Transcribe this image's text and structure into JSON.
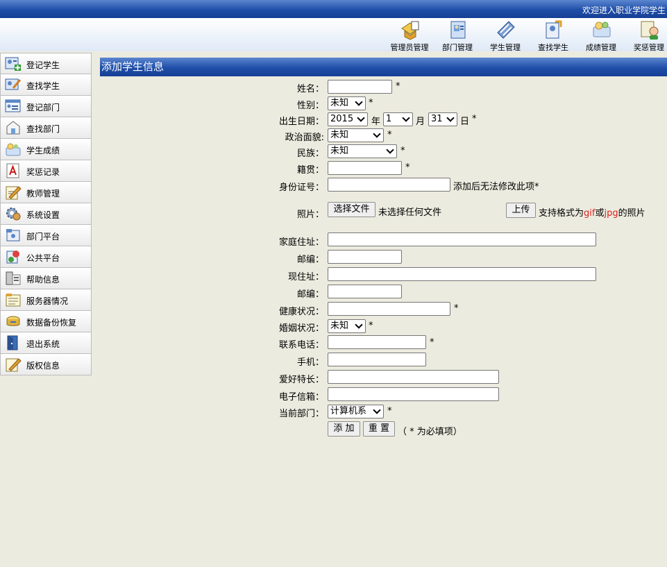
{
  "header": {
    "welcome": "欢迎进入职业学院学生"
  },
  "toolbar": [
    {
      "label": "管理员管理",
      "icon": "admin-icon"
    },
    {
      "label": "部门管理",
      "icon": "department-icon"
    },
    {
      "label": "学生管理",
      "icon": "student-icon"
    },
    {
      "label": "查找学生",
      "icon": "find-student-icon"
    },
    {
      "label": "成绩管理",
      "icon": "grades-icon"
    },
    {
      "label": "奖惩管理",
      "icon": "reward-icon"
    }
  ],
  "sidebar": [
    {
      "label": "登记学生"
    },
    {
      "label": "查找学生"
    },
    {
      "label": "登记部门"
    },
    {
      "label": "查找部门"
    },
    {
      "label": "学生成绩"
    },
    {
      "label": "奖惩记录"
    },
    {
      "label": "教师管理"
    },
    {
      "label": "系统设置"
    },
    {
      "label": "部门平台"
    },
    {
      "label": "公共平台"
    },
    {
      "label": "帮助信息"
    },
    {
      "label": "服务器情况"
    },
    {
      "label": "数据备份恢复"
    },
    {
      "label": "退出系统"
    },
    {
      "label": "版权信息"
    }
  ],
  "panel": {
    "title": "添加学生信息"
  },
  "form": {
    "name": {
      "label": "姓名："
    },
    "gender": {
      "label": "性别：",
      "value": "未知"
    },
    "birth": {
      "label": "出生日期：",
      "year": "2015",
      "year_unit": "年",
      "month": "1",
      "month_unit": "月",
      "day": "31",
      "day_unit": "日"
    },
    "political": {
      "label": "政治面貌:",
      "value": "未知"
    },
    "ethnicity": {
      "label": "民族：",
      "value": "未知"
    },
    "native": {
      "label": "籍贯："
    },
    "id_card": {
      "label": "身份证号：",
      "note": "添加后无法修改此项*"
    },
    "photo": {
      "label": "照片：",
      "choose": "选择文件",
      "no_file": "未选择任何文件",
      "upload": "上传",
      "hint_prefix": "支持格式为",
      "fmt1": "gif",
      "hint_or": "或",
      "fmt2": "jpg",
      "hint_suffix": "的照片"
    },
    "home_address": {
      "label": "家庭住址："
    },
    "zip1": {
      "label": "邮编："
    },
    "current_address": {
      "label": "现住址："
    },
    "zip2": {
      "label": "邮编："
    },
    "health": {
      "label": "健康状况："
    },
    "marital": {
      "label": "婚姻状况：",
      "value": "未知"
    },
    "phone": {
      "label": "联系电话："
    },
    "mobile": {
      "label": "手机："
    },
    "hobby": {
      "label": "爱好特长："
    },
    "email": {
      "label": "电子信箱："
    },
    "department": {
      "label": "当前部门：",
      "value": "计算机系"
    },
    "required_mark": "*",
    "submit": "添 加",
    "reset": "重 置",
    "required_note": "（ * 为必填项）"
  }
}
